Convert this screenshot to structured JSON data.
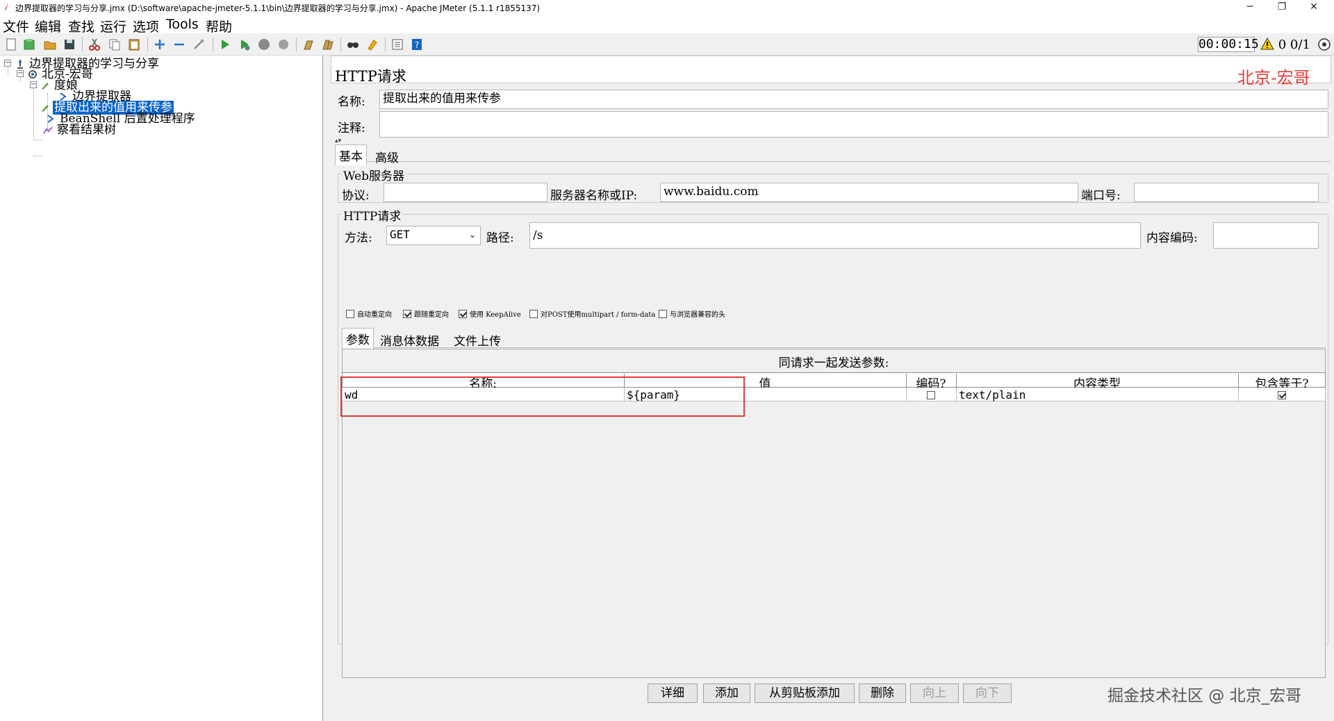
{
  "window": {
    "title": "边界提取器的学习与分享.jmx (D:\\software\\apache-jmeter-5.1.1\\bin\\边界提取器的学习与分享.jmx) - Apache JMeter (5.1.1 r1855137)",
    "minimize": "─",
    "maximize": "❐",
    "close": "✕"
  },
  "menu": [
    "文件",
    "编辑",
    "查找",
    "运行",
    "选项",
    "Tools",
    "帮助"
  ],
  "toolbar": {
    "timer": "00:00:15",
    "warning_count": "0",
    "thread_count": "0/1"
  },
  "tree": {
    "root": "边界提取器的学习与分享",
    "thread_group": "北京-宏哥",
    "sampler_baidu": "度娘",
    "boundary_extractor": "边界提取器",
    "sampler_param": "提取出来的值用来传参",
    "beanshell": "BeanShell 后置处理程序",
    "result_tree": "察看结果树"
  },
  "panel": {
    "heading": "HTTP请求",
    "watermark": "北京-宏哥",
    "name_label": "名称:",
    "name_value": "提取出来的值用来传参",
    "comment_label": "注释:",
    "comment_value": "",
    "tabs": [
      "基本",
      "高级"
    ],
    "web_server": {
      "legend": "Web服务器",
      "protocol_label": "协议:",
      "protocol_value": "",
      "server_label": "服务器名称或IP:",
      "server_value": "www.baidu.com",
      "port_label": "端口号:",
      "port_value": ""
    },
    "http_request": {
      "legend": "HTTP请求",
      "method_label": "方法:",
      "method_value": "GET",
      "path_label": "路径:",
      "path_value": "/s",
      "encoding_label": "内容编码:",
      "encoding_value": ""
    },
    "options": [
      {
        "label": "自动重定向",
        "checked": false
      },
      {
        "label": "跟随重定向",
        "checked": true
      },
      {
        "label": "使用 KeepAlive",
        "checked": true
      },
      {
        "label": "对POST使用multipart / form-data",
        "checked": false
      },
      {
        "label": "与浏览器兼容的头",
        "checked": false
      }
    ],
    "subtabs": [
      "参数",
      "消息体数据",
      "文件上传"
    ],
    "params_title": "同请求一起发送参数:",
    "columns": [
      "名称:",
      "值",
      "编码?",
      "内容类型",
      "包含等于?"
    ],
    "rows": [
      {
        "name": "wd",
        "value": "${param}",
        "encode": false,
        "content_type": "text/plain",
        "include_equals": true
      }
    ],
    "buttons": [
      {
        "label": "详细",
        "enabled": true
      },
      {
        "label": "添加",
        "enabled": true
      },
      {
        "label": "从剪贴板添加",
        "enabled": true
      },
      {
        "label": "删除",
        "enabled": true
      },
      {
        "label": "向上",
        "enabled": false
      },
      {
        "label": "向下",
        "enabled": false
      }
    ],
    "footer_watermark": "掘金技术社区 @ 北京_宏哥"
  },
  "colors": {
    "selection": "#0a64c8",
    "watermark_red": "#e53935",
    "highlight_box": "#e53935"
  }
}
